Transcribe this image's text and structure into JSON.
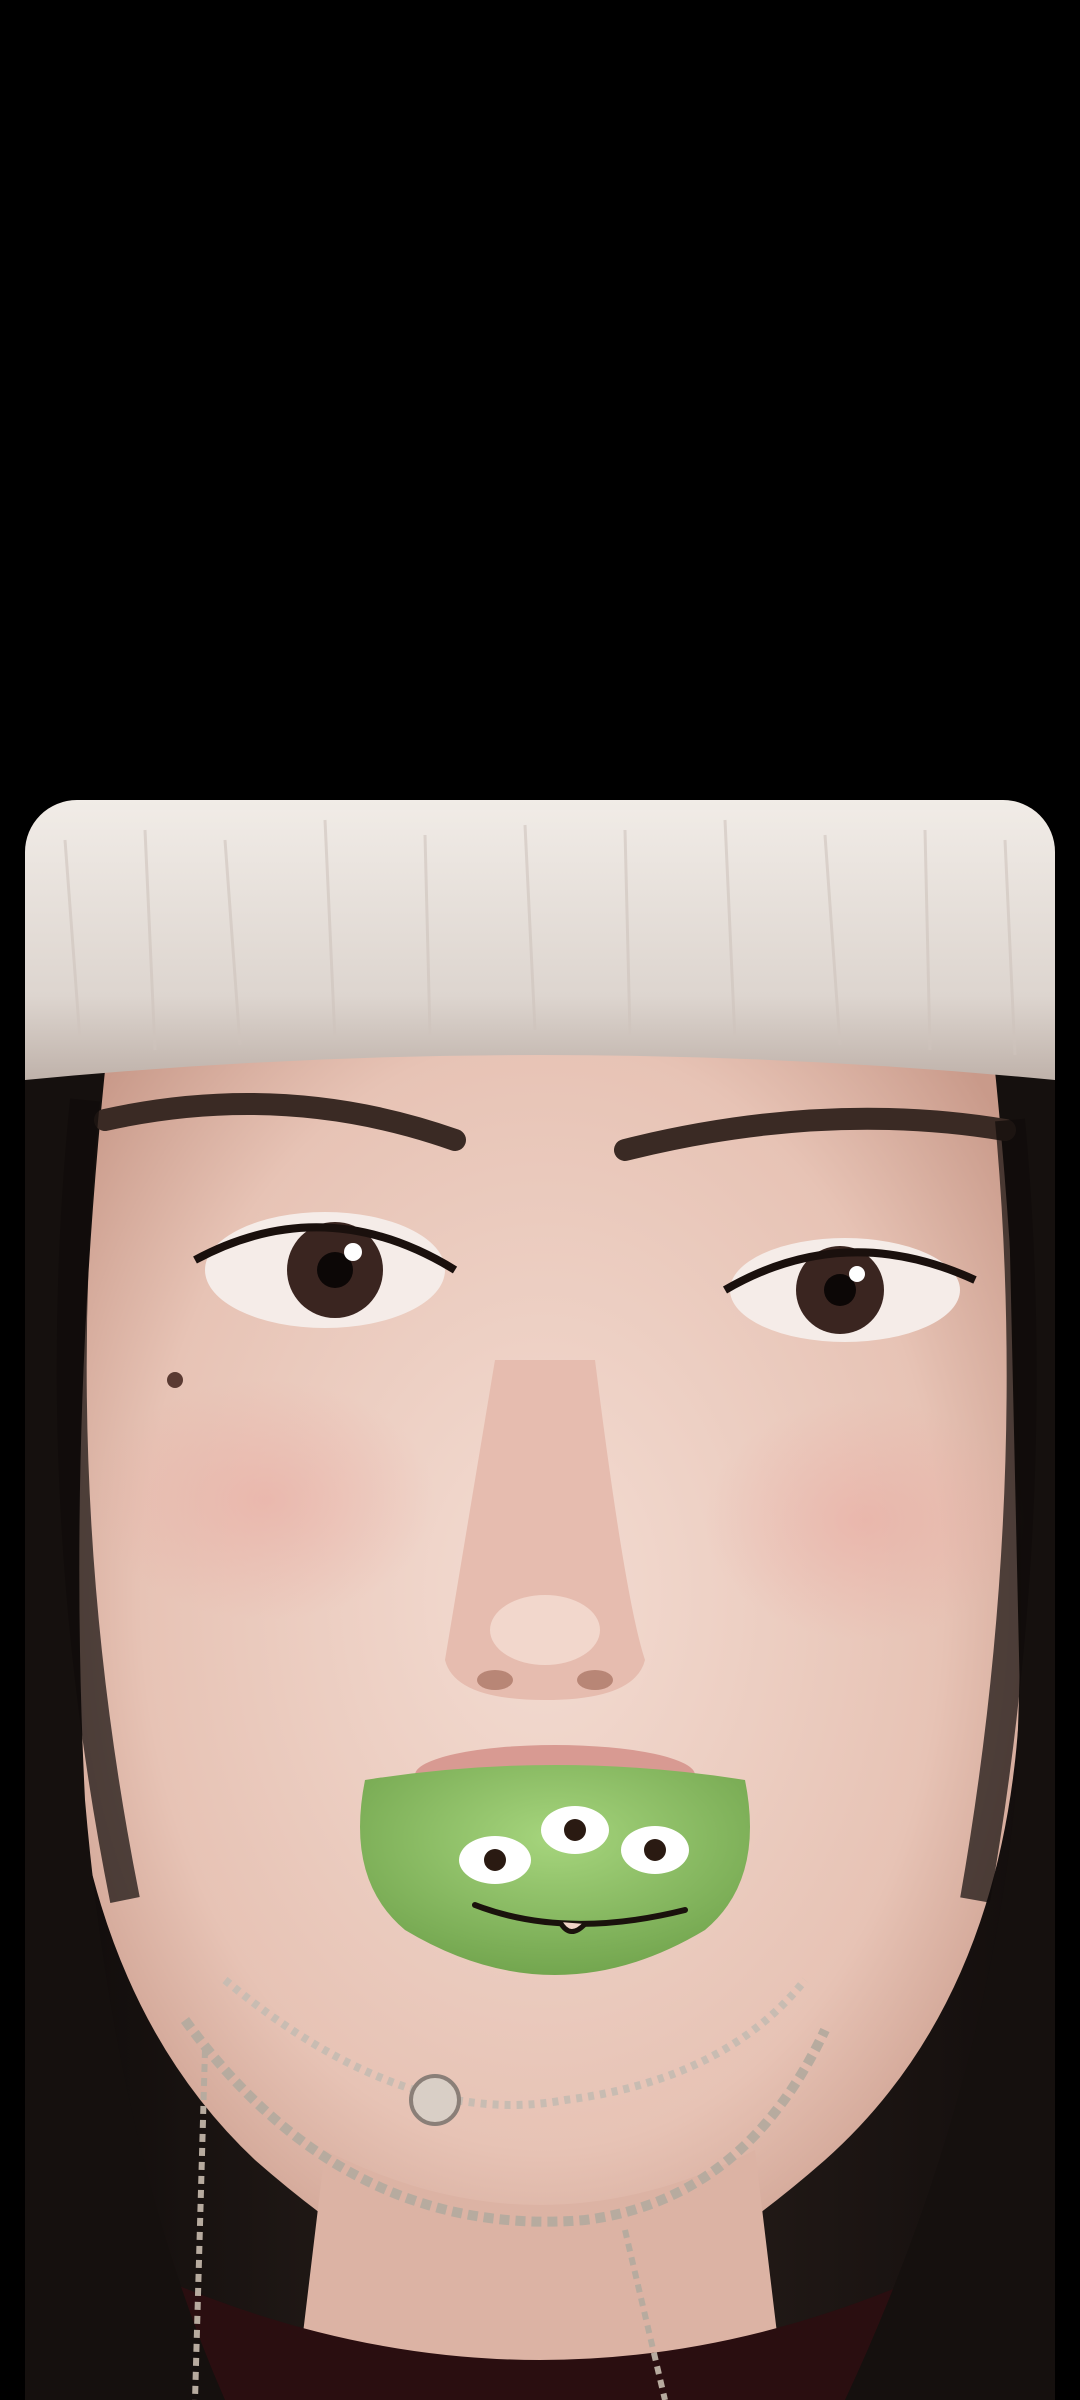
{
  "screen": {
    "background_color": "#000000"
  },
  "photo": {
    "subject_type": "selfie",
    "colors": {
      "hat_fur": "#e9e4df",
      "skin": "#ecd2c6",
      "hair": "#1a1412",
      "mouth_toy": "#8fc468",
      "sweater": "#2a0e10"
    }
  }
}
